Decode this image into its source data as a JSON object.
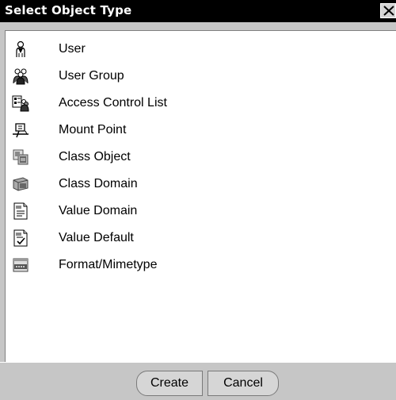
{
  "dialog": {
    "title": "Select Object Type",
    "close_icon": "close-icon"
  },
  "list": {
    "items": [
      {
        "label": "User",
        "icon": "user-icon"
      },
      {
        "label": "User Group",
        "icon": "user-group-icon"
      },
      {
        "label": "Access Control List",
        "icon": "access-control-list-icon"
      },
      {
        "label": "Mount Point",
        "icon": "mount-point-icon"
      },
      {
        "label": "Class Object",
        "icon": "class-object-icon"
      },
      {
        "label": "Class Domain",
        "icon": "class-domain-icon"
      },
      {
        "label": "Value Domain",
        "icon": "value-domain-icon"
      },
      {
        "label": "Value Default",
        "icon": "value-default-icon"
      },
      {
        "label": "Format/Mimetype",
        "icon": "format-mimetype-icon"
      }
    ]
  },
  "footer": {
    "create_label": "Create",
    "cancel_label": "Cancel"
  },
  "colors": {
    "titlebar_bg": "#000000",
    "titlebar_text": "#ffffff",
    "window_bg": "#c6c6c6",
    "list_bg": "#ffffff"
  }
}
